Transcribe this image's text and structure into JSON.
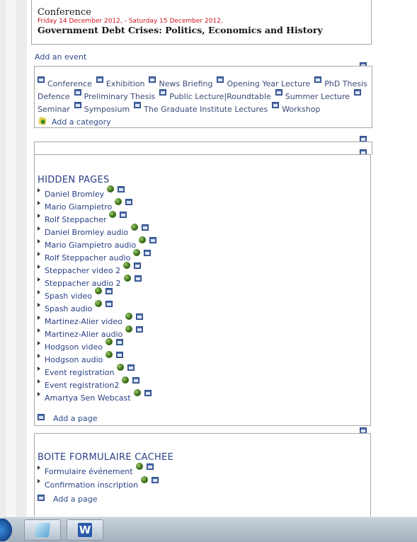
{
  "event": {
    "type": "Conference",
    "date": "Friday 14 December 2012, - Saturday 15 December 2012,",
    "title": "Government Debt Crises: Politics, Economics and History"
  },
  "add_event": "Add an event",
  "categories": [
    "Conference",
    "Exhibition",
    "News Briefing",
    "Opening Year Lecture",
    "PhD Thesis Defence",
    "Preliminary Thesis",
    "Public Lecture|Roundtable",
    "Summer Lecture",
    "Seminar",
    "Symposium",
    "The Graduate Institute Lectures",
    "Workshop"
  ],
  "add_category": "Add a category",
  "hidden_pages": {
    "title": "HIDDEN PAGES",
    "items": [
      "Daniel Bromley",
      "Mario Giampietro",
      "Rolf Steppacher",
      "Daniel Bromley audio",
      "Mario Giampietro audio",
      "Rolf Steppacher audio",
      "Steppacher video 2",
      "Steppacher audio 2",
      "Spash video",
      "Spash audio",
      "Martinez-Alier video",
      "Martinez-Alier audio",
      "Hodgson video",
      "Hodgson audio",
      "Event registration",
      "Event registration2",
      "Amartya Sen Webcast"
    ],
    "add": "Add a page"
  },
  "boite": {
    "title": "BOITE FORMULAIRE CACHEE",
    "items": [
      "Formulaire événement",
      "Confirmation inscription"
    ],
    "add": "Add a page"
  },
  "taskbar": {
    "word_label": "W"
  }
}
